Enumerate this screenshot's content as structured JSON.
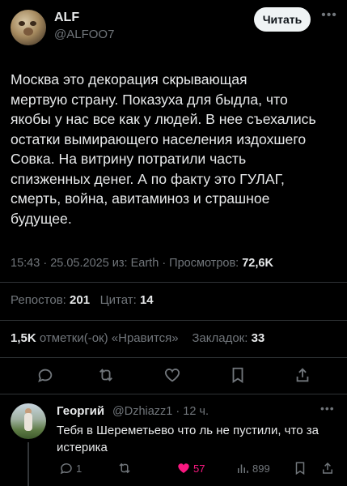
{
  "author": {
    "name": "ALF",
    "handle": "@ALFOO7",
    "follow_label": "Читать"
  },
  "tweet": {
    "lines": [
      "Москва это декорация скрывающая",
      "мертвую страну. Показуха для быдла, что",
      "якобы у нас все как у людей. В нее съехались",
      "остатки вымирающего населения издохшего",
      "Совка. На витрину потратили часть",
      "спизженных денег. А по факту это ГУЛАГ,",
      "смерть, война, авитаминоз и  страшное",
      "будущее."
    ],
    "time": "15:43",
    "date": "25.05.2025",
    "source_prefix": "из:",
    "source": "Earth",
    "views_label": "Просмотров:",
    "views": "72,6K"
  },
  "stats": {
    "reposts_label": "Репостов:",
    "reposts": "201",
    "quotes_label": "Цитат:",
    "quotes": "14",
    "likes": "1,5K",
    "likes_label": "отметки(-ок) «Нравится»",
    "bookmarks_label": "Закладок:",
    "bookmarks": "33"
  },
  "reply": {
    "name": "Георгий",
    "handle": "@Dzhiazz1",
    "time": "12 ч.",
    "text": "Тебя в Шереметьево что ль не пустили, что за истерика",
    "replies": "1",
    "likes": "57",
    "views": "899"
  },
  "colors": {
    "background": "#000000",
    "text": "#e7e9ea",
    "muted": "#71767b",
    "like_active": "#f91880"
  },
  "icons": [
    "reply-icon",
    "repost-icon",
    "like-icon",
    "bookmark-icon",
    "share-icon",
    "views-icon",
    "more-icon"
  ]
}
